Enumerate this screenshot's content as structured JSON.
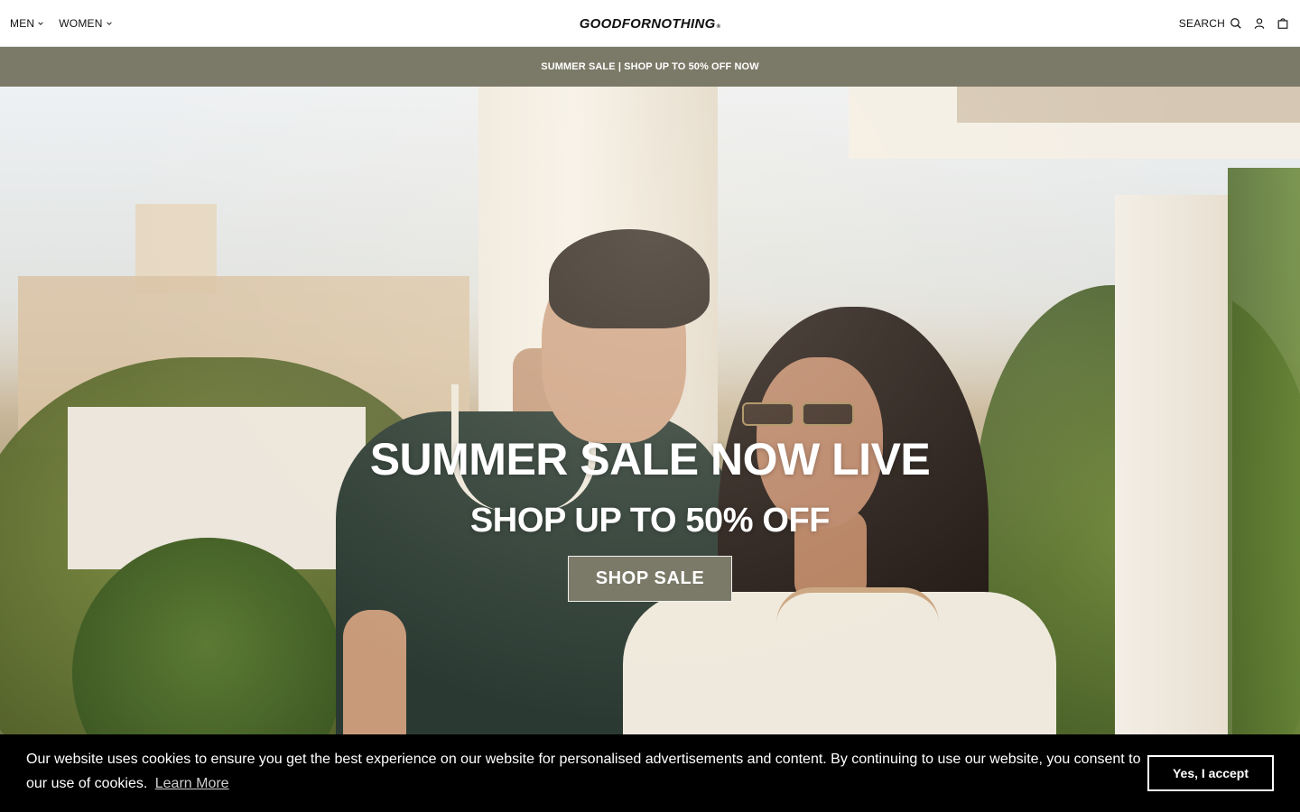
{
  "header": {
    "nav_left": [
      {
        "label": "MEN",
        "icon": "chevron-down-icon"
      },
      {
        "label": "WOMEN",
        "icon": "chevron-down-icon"
      }
    ],
    "logo_text": "GOODFORNOTHING",
    "logo_mark": "®",
    "search_label": "SEARCH",
    "icons": [
      "search-icon",
      "account-icon",
      "bag-icon"
    ]
  },
  "announcement": {
    "text": "SUMMER SALE | SHOP UP TO 50% OFF NOW",
    "background": "#7b7a68"
  },
  "hero": {
    "title": "SUMMER SALE NOW LIVE",
    "subtitle": "SHOP UP TO 50% OFF",
    "cta_label": "SHOP SALE",
    "cta_color": "#7b7a68"
  },
  "cookie_banner": {
    "text": "Our website uses cookies to ensure you get the best experience on our website for personalised advertisements and content. By continuing to use our website, you consent to our use of cookies.",
    "learn_more": "Learn More",
    "accept_label": "Yes, I accept"
  }
}
